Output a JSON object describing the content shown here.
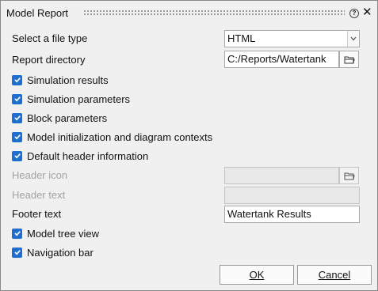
{
  "window": {
    "title": "Model Report",
    "help_glyph": "?",
    "close_glyph": "✕"
  },
  "file_type": {
    "label": "Select a file type",
    "value": "HTML"
  },
  "report_directory": {
    "label": "Report directory",
    "value": "C:/Reports/Watertank"
  },
  "checkboxes": [
    {
      "label": "Simulation results",
      "checked": true
    },
    {
      "label": "Simulation parameters",
      "checked": true
    },
    {
      "label": "Block parameters",
      "checked": true
    },
    {
      "label": "Model initialization and diagram contexts",
      "checked": true
    },
    {
      "label": "Default header information",
      "checked": true
    }
  ],
  "header_icon": {
    "label": "Header icon",
    "value": "",
    "disabled": true
  },
  "header_text": {
    "label": "Header text",
    "value": "",
    "disabled": true
  },
  "footer_text": {
    "label": "Footer text",
    "value": "Watertank Results"
  },
  "bottom_checkboxes": [
    {
      "label": "Model tree view",
      "checked": true
    },
    {
      "label": "Navigation bar",
      "checked": true
    }
  ],
  "buttons": {
    "ok": "OK",
    "cancel": "Cancel"
  },
  "colors": {
    "accent": "#1f6fd0",
    "background": "#f0f0f0"
  },
  "icons": {
    "folder": "folder-icon",
    "dropdown": "chevron-down-icon",
    "check": "check-icon"
  }
}
